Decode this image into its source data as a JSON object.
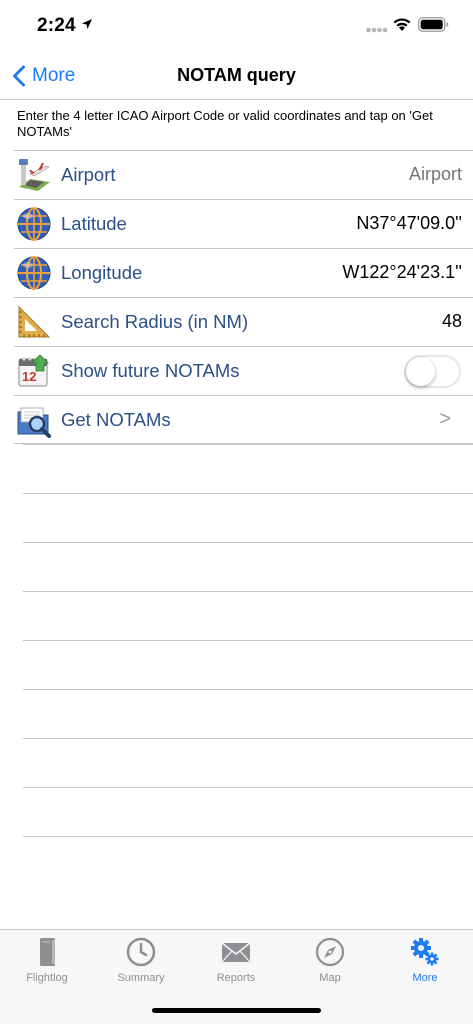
{
  "status_bar": {
    "time": "2:24"
  },
  "nav": {
    "back_label": "More",
    "title": "NOTAM query"
  },
  "instructions": "Enter the 4 letter ICAO Airport Code or valid coordinates and tap on 'Get NOTAMs'",
  "rows": {
    "airport": {
      "label": "Airport",
      "placeholder": "Airport",
      "icon": "airport-icon"
    },
    "latitude": {
      "label": "Latitude",
      "value": "N37°47'09.0''",
      "icon": "globe-icon"
    },
    "longitude": {
      "label": "Longitude",
      "value": "W122°24'23.1''",
      "icon": "globe-icon"
    },
    "radius": {
      "label": "Search Radius (in NM)",
      "value": "48",
      "icon": "ruler-triangle-icon"
    },
    "future": {
      "label": "Show future NOTAMs",
      "toggle_on": false,
      "icon": "calendar-icon"
    },
    "get": {
      "label": "Get NOTAMs",
      "chevron": ">",
      "icon": "search-folder-icon"
    }
  },
  "tabs": [
    {
      "label": "Flightlog",
      "icon": "book-icon",
      "active": false
    },
    {
      "label": "Summary",
      "icon": "clock-icon",
      "active": false
    },
    {
      "label": "Reports",
      "icon": "envelope-icon",
      "active": false
    },
    {
      "label": "Map",
      "icon": "compass-icon",
      "active": false
    },
    {
      "label": "More",
      "icon": "gears-icon",
      "active": true
    }
  ],
  "colors": {
    "accent": "#1f7cf5",
    "label_blue": "#2b4f88",
    "tab_inactive": "#8e8e93"
  }
}
